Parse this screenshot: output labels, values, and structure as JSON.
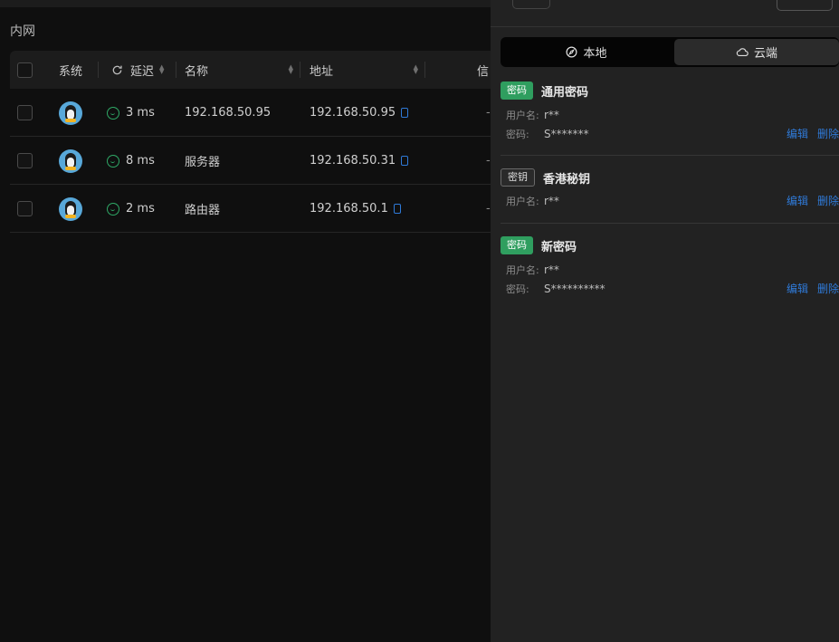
{
  "section_title": "内网",
  "table": {
    "columns": {
      "system": "系统",
      "latency": "延迟",
      "name": "名称",
      "address": "地址",
      "info": "信"
    },
    "rows": [
      {
        "latency": "3 ms",
        "name": "192.168.50.95",
        "address": "192.168.50.95",
        "info": "-"
      },
      {
        "latency": "8 ms",
        "name": "服务器",
        "address": "192.168.50.31",
        "info": "-"
      },
      {
        "latency": "2 ms",
        "name": "路由器",
        "address": "192.168.50.1",
        "info": "-"
      }
    ]
  },
  "drawer": {
    "segments": [
      {
        "label": "本地",
        "icon": "compass-icon",
        "active": false
      },
      {
        "label": "云端",
        "icon": "cloud-icon",
        "active": true
      }
    ],
    "entries": [
      {
        "tag": "密码",
        "tag_type": "password",
        "title": "通用密码",
        "fields": [
          {
            "label": "用户名:",
            "value": "r**"
          },
          {
            "label": "密码:",
            "value": "S*******"
          }
        ],
        "edit": "编辑",
        "delete": "删除"
      },
      {
        "tag": "密钥",
        "tag_type": "key",
        "title": "香港秘钥",
        "fields": [
          {
            "label": "用户名:",
            "value": "r**"
          }
        ],
        "edit": "编辑",
        "delete": "删除"
      },
      {
        "tag": "密码",
        "tag_type": "password",
        "title": "新密码",
        "fields": [
          {
            "label": "用户名:",
            "value": "r**"
          },
          {
            "label": "密码:",
            "value": "S**********"
          }
        ],
        "edit": "编辑",
        "delete": "删除"
      }
    ]
  },
  "colors": {
    "accent_link": "#2f7ad8",
    "status_ok": "#2fa866",
    "tag_password": "#2f9e5f"
  }
}
